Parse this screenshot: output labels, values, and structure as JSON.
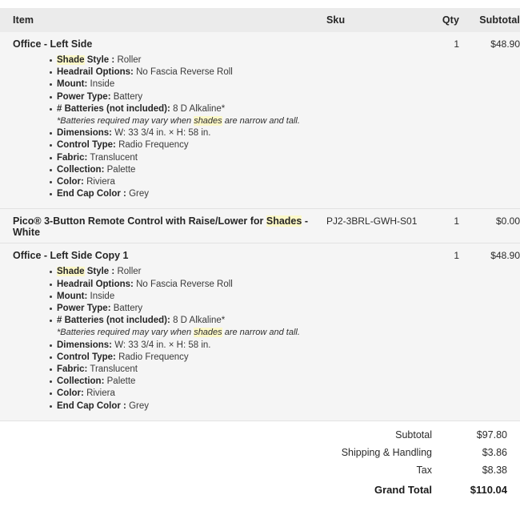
{
  "table": {
    "headers": {
      "item": "Item",
      "sku": "Sku",
      "qty": "Qty",
      "subtotal": "Subtotal"
    },
    "rows": [
      {
        "name": "Office - Left Side",
        "sku": "",
        "qty": "1",
        "subtotal": "$48.90",
        "options": [
          {
            "label_pre": "",
            "label_hl": "Shade",
            "label_post": " Style :",
            "value": "Roller"
          },
          {
            "label_pre": "Headrail Options:",
            "label_hl": "",
            "label_post": "",
            "value": "No Fascia Reverse Roll"
          },
          {
            "label_pre": "Mount:",
            "label_hl": "",
            "label_post": "",
            "value": "Inside"
          },
          {
            "label_pre": "Power Type:",
            "label_hl": "",
            "label_post": "",
            "value": "Battery"
          },
          {
            "label_pre": "# Batteries (not included):",
            "label_hl": "",
            "label_post": "",
            "value": "8 D Alkaline*"
          }
        ],
        "note_pre": "*Batteries required may vary when ",
        "note_hl": "shades",
        "note_post": " are narrow and tall.",
        "options_after": [
          {
            "label_pre": "Dimensions:",
            "label_hl": "",
            "label_post": "",
            "value": "W: 33 3/4 in. × H: 58 in."
          },
          {
            "label_pre": "Control Type:",
            "label_hl": "",
            "label_post": "",
            "value": "Radio Frequency"
          },
          {
            "label_pre": "Fabric:",
            "label_hl": "",
            "label_post": "",
            "value": "Translucent"
          },
          {
            "label_pre": "Collection:",
            "label_hl": "",
            "label_post": "",
            "value": "Palette"
          },
          {
            "label_pre": "Color:",
            "label_hl": "",
            "label_post": "",
            "value": "Riviera"
          },
          {
            "label_pre": "End Cap Color :",
            "label_hl": "",
            "label_post": "",
            "value": "Grey"
          }
        ]
      },
      {
        "name_pre": "Pico® 3-Button Remote Control with Raise/Lower for ",
        "name_hl": "Shades",
        "name_post": " - White",
        "sku": "PJ2-3BRL-GWH-S01",
        "qty": "1",
        "subtotal": "$0.00",
        "options": [],
        "options_after": []
      },
      {
        "name": "Office - Left Side Copy 1",
        "sku": "",
        "qty": "1",
        "subtotal": "$48.90",
        "options": [
          {
            "label_pre": "",
            "label_hl": "Shade",
            "label_post": " Style :",
            "value": "Roller"
          },
          {
            "label_pre": "Headrail Options:",
            "label_hl": "",
            "label_post": "",
            "value": "No Fascia Reverse Roll"
          },
          {
            "label_pre": "Mount:",
            "label_hl": "",
            "label_post": "",
            "value": "Inside"
          },
          {
            "label_pre": "Power Type:",
            "label_hl": "",
            "label_post": "",
            "value": "Battery"
          },
          {
            "label_pre": "# Batteries (not included):",
            "label_hl": "",
            "label_post": "",
            "value": "8 D Alkaline*"
          }
        ],
        "note_pre": "*Batteries required may vary when ",
        "note_hl": "shades",
        "note_post": " are narrow and tall.",
        "options_after": [
          {
            "label_pre": "Dimensions:",
            "label_hl": "",
            "label_post": "",
            "value": "W: 33 3/4 in. × H: 58 in."
          },
          {
            "label_pre": "Control Type:",
            "label_hl": "",
            "label_post": "",
            "value": "Radio Frequency"
          },
          {
            "label_pre": "Fabric:",
            "label_hl": "",
            "label_post": "",
            "value": "Translucent"
          },
          {
            "label_pre": "Collection:",
            "label_hl": "",
            "label_post": "",
            "value": "Palette"
          },
          {
            "label_pre": "Color:",
            "label_hl": "",
            "label_post": "",
            "value": "Riviera"
          },
          {
            "label_pre": "End Cap Color :",
            "label_hl": "",
            "label_post": "",
            "value": "Grey"
          }
        ]
      }
    ]
  },
  "totals": [
    {
      "label": "Subtotal",
      "value": "$97.80",
      "grand": false
    },
    {
      "label": "Shipping & Handling",
      "value": "$3.86",
      "grand": false
    },
    {
      "label": "Tax",
      "value": "$8.38",
      "grand": false
    },
    {
      "label": "Grand Total",
      "value": "$110.04",
      "grand": true
    }
  ],
  "colors": {
    "header_bg": "#ebebeb",
    "row_bg": "#f5f5f5",
    "totals_bg": "#ffffff",
    "highlight": "#fcf8c8",
    "divider": "#e2e2e2",
    "text": "#2b2b2b"
  }
}
